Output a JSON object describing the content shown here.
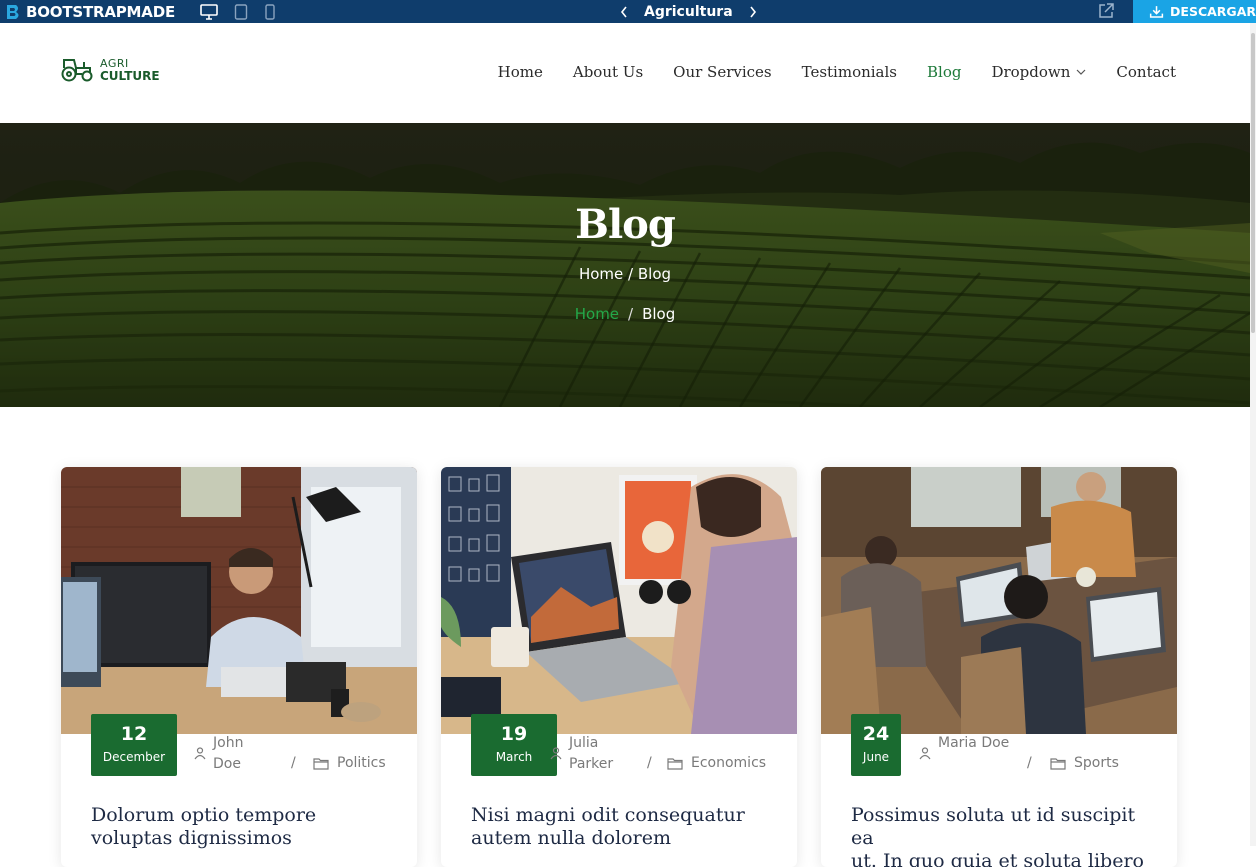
{
  "topbar": {
    "brand": "BOOTSTRAPMADE",
    "template_name": "Agricultura",
    "download_label": "DESCARGAR"
  },
  "header": {
    "logo_top": "AGRI",
    "logo_bottom": "CULTURE",
    "nav": [
      {
        "label": "Home",
        "active": false
      },
      {
        "label": "About Us",
        "active": false
      },
      {
        "label": "Our Services",
        "active": false
      },
      {
        "label": "Testimonials",
        "active": false
      },
      {
        "label": "Blog",
        "active": true
      },
      {
        "label": "Dropdown",
        "active": false
      },
      {
        "label": "Contact",
        "active": false
      }
    ]
  },
  "hero": {
    "title": "Blog",
    "subtitle": "Home / Blog",
    "breadcrumb_home": "Home",
    "breadcrumb_sep": "/",
    "breadcrumb_current": "Blog"
  },
  "posts": [
    {
      "day": "12",
      "month": "December",
      "author_first": "John",
      "author_last": "Doe",
      "sep": "/",
      "category": "Politics",
      "title_line1": "Dolorum optio tempore",
      "title_line2": "voluptas dignissimos"
    },
    {
      "day": "19",
      "month": "March",
      "author_first": "Julia",
      "author_last": "Parker",
      "sep": "/",
      "category": "Economics",
      "title_line1": "Nisi magni odit consequatur",
      "title_line2": "autem nulla dolorem"
    },
    {
      "day": "24",
      "month": "June",
      "author_first": "",
      "author_last": "Maria Doe",
      "sep": "/",
      "category": "Sports",
      "title_line1": "Possimus soluta ut id suscipit ea",
      "title_line2": "ut. In quo quia et soluta libero"
    }
  ],
  "colors": {
    "topbar_bg": "#0f3d6c",
    "download_bg": "#1aa4e5",
    "brand_green": "#1a6b30",
    "active_nav": "#1e7a3a",
    "breadcrumb_home": "#23a84a"
  }
}
